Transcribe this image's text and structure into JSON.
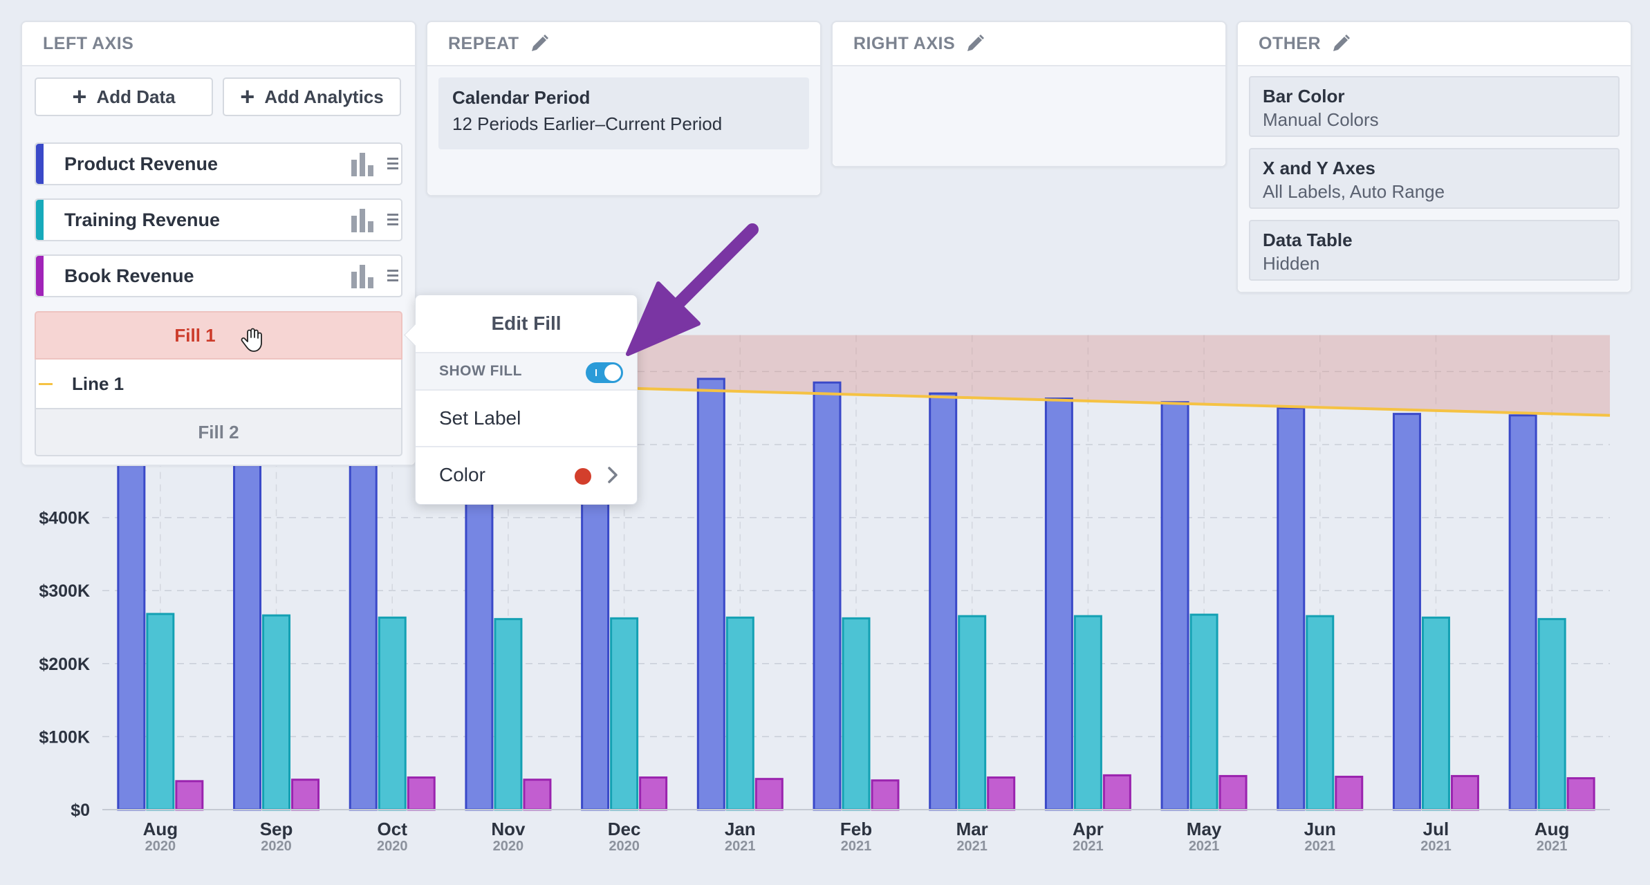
{
  "panels": {
    "left_axis": {
      "title": "LEFT AXIS",
      "add_data_label": "Add Data",
      "add_analytics_label": "Add Analytics",
      "series": [
        {
          "label": "Product Revenue",
          "color": "#3a49c8"
        },
        {
          "label": "Training Revenue",
          "color": "#17aabb"
        },
        {
          "label": "Book Revenue",
          "color": "#a124b8"
        }
      ],
      "fill1_label": "Fill 1",
      "line1_label": "Line 1",
      "fill2_label": "Fill 2"
    },
    "repeat": {
      "title": "REPEAT",
      "card_title": "Calendar Period",
      "card_value": "12 Periods Earlier–Current Period"
    },
    "right_axis": {
      "title": "RIGHT AXIS"
    },
    "other": {
      "title": "OTHER",
      "cards": [
        {
          "title": "Bar Color",
          "value": "Manual Colors"
        },
        {
          "title": "X and Y Axes",
          "value": "All Labels, Auto Range"
        },
        {
          "title": "Data Table",
          "value": "Hidden"
        }
      ]
    }
  },
  "popup": {
    "title": "Edit Fill",
    "show_fill_label": "SHOW FILL",
    "show_fill_on": true,
    "set_label": "Set Label",
    "color_label": "Color",
    "color_value": "#d33f2c"
  },
  "chart_data": {
    "type": "bar",
    "categories": [
      "Aug",
      "Sep",
      "Oct",
      "Nov",
      "Dec",
      "Jan",
      "Feb",
      "Mar",
      "Apr",
      "May",
      "Jun",
      "Jul",
      "Aug"
    ],
    "category_years": [
      "2020",
      "2020",
      "2020",
      "2020",
      "2020",
      "2021",
      "2021",
      "2021",
      "2021",
      "2021",
      "2021",
      "2021",
      "2021"
    ],
    "series": [
      {
        "name": "Product Revenue",
        "color": "#7686e3",
        "values": [
          580,
          580,
          580,
          580,
          580,
          590,
          585,
          570,
          563,
          558,
          550,
          542,
          540
        ]
      },
      {
        "name": "Training Revenue",
        "color": "#4cc3d4",
        "values": [
          268,
          266,
          263,
          261,
          262,
          263,
          262,
          265,
          265,
          267,
          265,
          263,
          261
        ]
      },
      {
        "name": "Book Revenue",
        "color": "#c25ed0",
        "values": [
          39,
          41,
          44,
          41,
          44,
          42,
          40,
          44,
          47,
          46,
          45,
          46,
          43
        ]
      }
    ],
    "line": {
      "name": "Line 1",
      "color": "#f5c243",
      "start": 597,
      "end": 540
    },
    "fill": {
      "name": "Fill 1",
      "color": "#d88b86",
      "top": 650
    },
    "y_ticks": [
      0,
      100,
      200,
      300,
      400
    ],
    "y_tick_labels": [
      "$0",
      "$100K",
      "$200K",
      "$300K",
      "$400K"
    ],
    "ylim": [
      0,
      650
    ],
    "grid": true
  }
}
